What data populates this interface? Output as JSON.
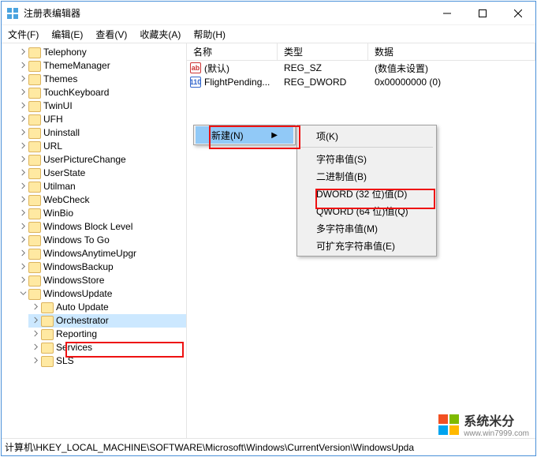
{
  "title": "注册表编辑器",
  "menu": {
    "file": "文件(F)",
    "edit": "编辑(E)",
    "view": "查看(V)",
    "fav": "收藏夹(A)",
    "help": "帮助(H)"
  },
  "tree": {
    "items": [
      "Telephony",
      "ThemeManager",
      "Themes",
      "TouchKeyboard",
      "TwinUI",
      "UFH",
      "Uninstall",
      "URL",
      "UserPictureChange",
      "UserState",
      "Utilman",
      "WebCheck",
      "WinBio",
      "Windows Block Level",
      "Windows To Go",
      "WindowsAnytimeUpgr",
      "WindowsBackup",
      "WindowsStore"
    ],
    "wu": "WindowsUpdate",
    "wu_children": [
      "Auto Update",
      "Orchestrator",
      "Reporting",
      "Services",
      "SLS"
    ]
  },
  "list": {
    "headers": {
      "name": "名称",
      "type": "类型",
      "data": "数据"
    },
    "rows": [
      {
        "icon": "sz",
        "name": "(默认)",
        "type": "REG_SZ",
        "data": "(数值未设置)"
      },
      {
        "icon": "dw",
        "name": "FlightPending...",
        "type": "REG_DWORD",
        "data": "0x00000000 (0)"
      }
    ]
  },
  "cm1": {
    "new": "新建(N)"
  },
  "cm2": {
    "key": "项(K)",
    "string": "字符串值(S)",
    "binary": "二进制值(B)",
    "dword": "DWORD (32 位)值(D)",
    "qword": "QWORD (64 位)值(Q)",
    "multi": "多字符串值(M)",
    "expand": "可扩充字符串值(E)"
  },
  "status": "计算机\\HKEY_LOCAL_MACHINE\\SOFTWARE\\Microsoft\\Windows\\CurrentVersion\\WindowsUpda",
  "brand": {
    "name": "系统米分",
    "url": "www.win7999.com"
  }
}
